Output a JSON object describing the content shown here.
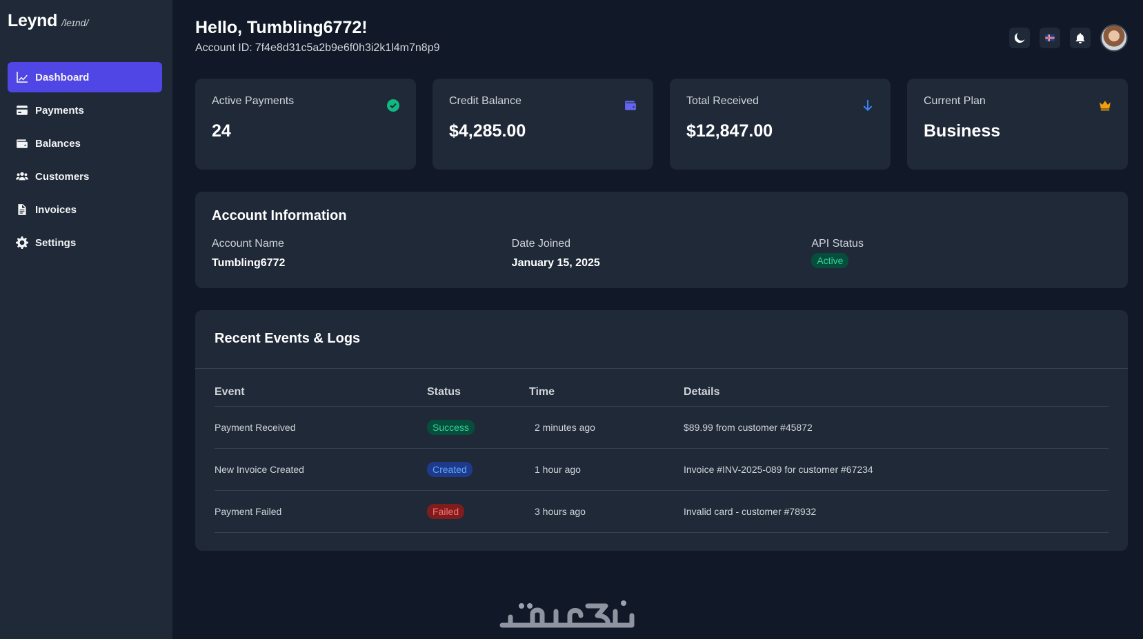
{
  "brand": {
    "name": "Leynd",
    "phonetic": "/leɪnd/"
  },
  "sidebar": {
    "items": [
      {
        "label": "Dashboard",
        "icon": "chart-line-icon",
        "active": true
      },
      {
        "label": "Payments",
        "icon": "credit-card-icon",
        "active": false
      },
      {
        "label": "Balances",
        "icon": "wallet-icon",
        "active": false
      },
      {
        "label": "Customers",
        "icon": "users-icon",
        "active": false
      },
      {
        "label": "Invoices",
        "icon": "file-invoice-icon",
        "active": false
      },
      {
        "label": "Settings",
        "icon": "gear-icon",
        "active": false
      }
    ]
  },
  "header": {
    "greeting": "Hello, Tumbling6772!",
    "account_id_label": "Account ID:",
    "account_id": "7f4e8d31c5a2b9e6f0h3i2k1l4m7n8p9"
  },
  "topbar": {
    "icons": [
      "moon-icon",
      "flag-icon",
      "bell-icon",
      "avatar"
    ]
  },
  "stats": [
    {
      "label": "Active Payments",
      "value": "24",
      "icon": "check-circle-icon",
      "color": "#10b981"
    },
    {
      "label": "Credit Balance",
      "value": "$4,285.00",
      "icon": "wallet-icon",
      "color": "#6366f1"
    },
    {
      "label": "Total Received",
      "value": "$12,847.00",
      "icon": "arrow-down-icon",
      "color": "#3b82f6"
    },
    {
      "label": "Current Plan",
      "value": "Business",
      "icon": "crown-icon",
      "color": "#f59e0b"
    }
  ],
  "account_info": {
    "title": "Account Information",
    "fields": [
      {
        "label": "Account Name",
        "value": "Tumbling6772"
      },
      {
        "label": "Date Joined",
        "value": "January 15, 2025"
      }
    ],
    "api_status_label": "API Status",
    "api_status_value": "Active"
  },
  "events": {
    "title": "Recent Events & Logs",
    "columns": [
      "Event",
      "Status",
      "Time",
      "Details"
    ],
    "rows": [
      {
        "event": "Payment Received",
        "status": "Success",
        "status_color": "green",
        "time": "2 minutes ago",
        "details": "$89.99 from customer #45872"
      },
      {
        "event": "New Invoice Created",
        "status": "Created",
        "status_color": "blue",
        "time": "1 hour ago",
        "details": "Invoice #INV-2025-089 for customer #67234"
      },
      {
        "event": "Payment Failed",
        "status": "Failed",
        "status_color": "red",
        "time": "3 hours ago",
        "details": "Invalid card - customer #78932"
      }
    ]
  },
  "watermark": {
    "text": "خمسات"
  }
}
